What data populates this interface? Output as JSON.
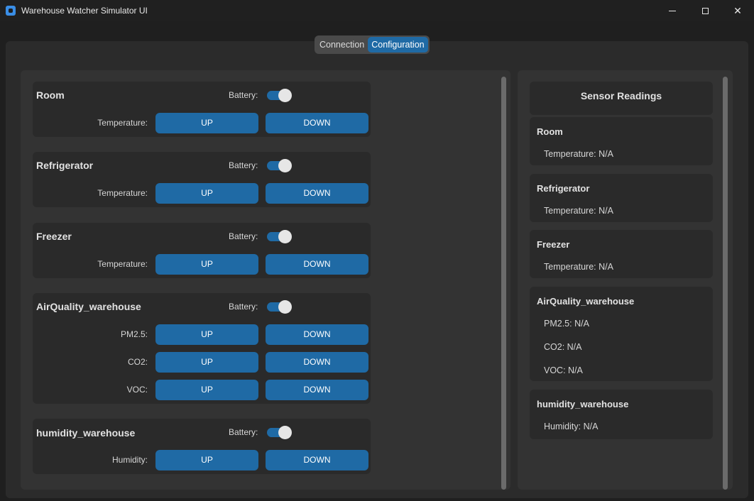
{
  "window": {
    "title": "Warehouse Watcher Simulator UI",
    "minimize_icon": "minimize-icon",
    "maximize_icon": "maximize-icon",
    "close_glyph": "✕"
  },
  "tabs": [
    {
      "label": "Connection",
      "active": false
    },
    {
      "label": "Configuration",
      "active": true
    }
  ],
  "colors": {
    "accent": "#1f6aa5",
    "background": "#1f1f1f",
    "panel": "#2b2b2b",
    "card": "#2a2a2a",
    "toggle_knob": "#e6e6e6"
  },
  "devices": [
    {
      "name": "Room",
      "battery_label": "Battery:",
      "battery_on": true,
      "rows": [
        {
          "label": "Temperature:",
          "up": "UP",
          "down": "DOWN"
        }
      ]
    },
    {
      "name": "Refrigerator",
      "battery_label": "Battery:",
      "battery_on": true,
      "rows": [
        {
          "label": "Temperature:",
          "up": "UP",
          "down": "DOWN"
        }
      ]
    },
    {
      "name": "Freezer",
      "battery_label": "Battery:",
      "battery_on": true,
      "rows": [
        {
          "label": "Temperature:",
          "up": "UP",
          "down": "DOWN"
        }
      ]
    },
    {
      "name": "AirQuality_warehouse",
      "battery_label": "Battery:",
      "battery_on": true,
      "rows": [
        {
          "label": "PM2.5:",
          "up": "UP",
          "down": "DOWN"
        },
        {
          "label": "CO2:",
          "up": "UP",
          "down": "DOWN"
        },
        {
          "label": "VOC:",
          "up": "UP",
          "down": "DOWN"
        }
      ]
    },
    {
      "name": "humidity_warehouse",
      "battery_label": "Battery:",
      "battery_on": true,
      "rows": [
        {
          "label": "Humidity:",
          "up": "UP",
          "down": "DOWN"
        }
      ]
    }
  ],
  "sensor_readings": {
    "title": "Sensor Readings",
    "sensors": [
      {
        "name": "Room",
        "values": [
          "Temperature: N/A"
        ]
      },
      {
        "name": "Refrigerator",
        "values": [
          "Temperature: N/A"
        ]
      },
      {
        "name": "Freezer",
        "values": [
          "Temperature: N/A"
        ]
      },
      {
        "name": "AirQuality_warehouse",
        "values": [
          "PM2.5: N/A",
          "CO2: N/A",
          "VOC: N/A"
        ]
      },
      {
        "name": "humidity_warehouse",
        "values": [
          "Humidity: N/A"
        ]
      }
    ]
  }
}
